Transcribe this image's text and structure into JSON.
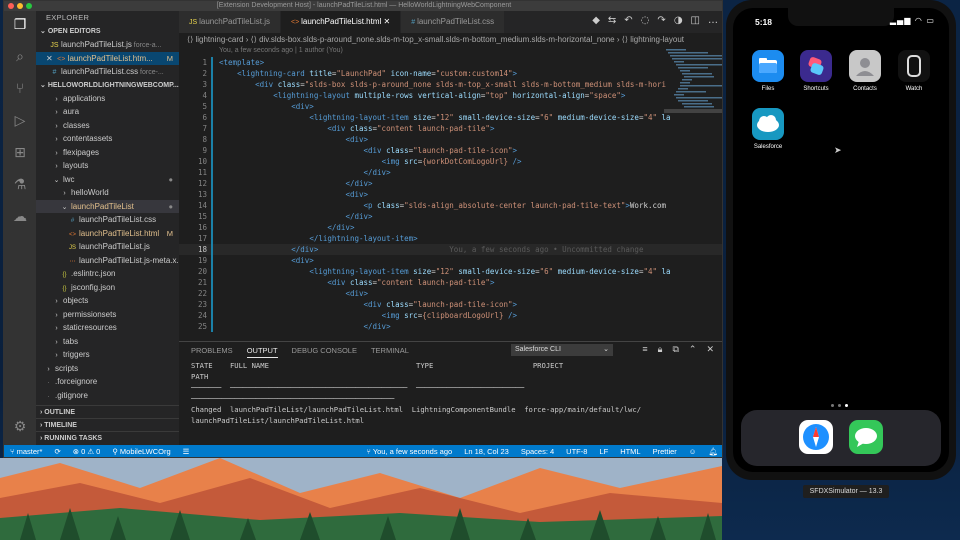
{
  "window": {
    "title": "[Extension Development Host] - launchPadTileList.html — HelloWorldLightningWebComponent"
  },
  "sidebar": {
    "explorer_title": "EXPLORER",
    "open_editors_title": "OPEN EDITORS",
    "open_editors": [
      {
        "icon": "JS",
        "name": "launchPadTileList.js",
        "extra": "force-a...",
        "mark": ""
      },
      {
        "icon": "<>",
        "name": "launchPadTileList.htm...",
        "extra": "",
        "mark": "M",
        "close": "✕"
      },
      {
        "icon": "#",
        "name": "launchPadTileList.css",
        "extra": "force-...",
        "mark": ""
      }
    ],
    "project_title": "HELLOWORLDLIGHTNINGWEBCOMP...",
    "tree": [
      {
        "name": "applications",
        "type": "folder",
        "indent": 1
      },
      {
        "name": "aura",
        "type": "folder",
        "indent": 1
      },
      {
        "name": "classes",
        "type": "folder",
        "indent": 1
      },
      {
        "name": "contentassets",
        "type": "folder",
        "indent": 1
      },
      {
        "name": "flexipages",
        "type": "folder",
        "indent": 1
      },
      {
        "name": "layouts",
        "type": "folder",
        "indent": 1
      },
      {
        "name": "lwc",
        "type": "folder-open",
        "indent": 1,
        "mark": "●"
      },
      {
        "name": "helloWorld",
        "type": "folder",
        "indent": 2
      },
      {
        "name": "launchPadTileList",
        "type": "folder-open",
        "indent": 2,
        "mark": "●"
      },
      {
        "name": "launchPadTileList.css",
        "type": "css",
        "indent": 3
      },
      {
        "name": "launchPadTileList.html",
        "type": "html",
        "indent": 3,
        "mark": "M"
      },
      {
        "name": "launchPadTileList.js",
        "type": "js",
        "indent": 3
      },
      {
        "name": "launchPadTileList.js-meta.x...",
        "type": "xml",
        "indent": 3
      },
      {
        "name": ".eslintrc.json",
        "type": "json",
        "indent": 2
      },
      {
        "name": "jsconfig.json",
        "type": "json",
        "indent": 2
      },
      {
        "name": "objects",
        "type": "folder",
        "indent": 1
      },
      {
        "name": "permissionsets",
        "type": "folder",
        "indent": 1
      },
      {
        "name": "staticresources",
        "type": "folder",
        "indent": 1
      },
      {
        "name": "tabs",
        "type": "folder",
        "indent": 1
      },
      {
        "name": "triggers",
        "type": "folder",
        "indent": 1
      },
      {
        "name": "scripts",
        "type": "folder",
        "indent": 0
      },
      {
        "name": ".forceignore",
        "type": "file",
        "indent": 0
      },
      {
        "name": ".gitignore",
        "type": "file",
        "indent": 0
      }
    ],
    "bottom_sections": [
      "OUTLINE",
      "TIMELINE",
      "RUNNING TASKS"
    ]
  },
  "tabs": [
    {
      "label": "launchPadTileList.js",
      "icon": "JS"
    },
    {
      "label": "launchPadTileList.html",
      "icon": "<>",
      "active": true,
      "close": "✕"
    },
    {
      "label": "launchPadTileList.css",
      "icon": "#"
    }
  ],
  "breadcrumb": "⟨⟩ lightning-card  ›  ⟨⟩ div.slds-box.slds-p-around_none.slds-m-top_x-small.slds-m-bottom_medium.slds-m-horizontal_none  ›  ⟨⟩ lightning-layout",
  "blame": "You, a few seconds ago | 1 author (You)",
  "code_lines": [
    {
      "n": "1",
      "html": "<span class='tag'>&lt;template&gt;</span>"
    },
    {
      "n": "2",
      "html": "    <span class='tag'>&lt;lightning-card</span> <span class='attr'>title</span><span class='txt'>=</span><span class='str'>\"LaunchPad\"</span> <span class='attr'>icon-name</span><span class='txt'>=</span><span class='str'>\"custom:custom14\"</span><span class='tag'>&gt;</span>"
    },
    {
      "n": "3",
      "html": "        <span class='tag'>&lt;div</span> <span class='attr'>class</span><span class='txt'>=</span><span class='str'>\"slds-box slds-p-around_none slds-m-top_x-small slds-m-bottom_medium slds-m-hori</span>"
    },
    {
      "n": "4",
      "html": "            <span class='tag'>&lt;lightning-layout</span> <span class='attr'>multiple-rows</span> <span class='attr'>vertical-align</span><span class='txt'>=</span><span class='str'>\"top\"</span> <span class='attr'>horizontal-align</span><span class='txt'>=</span><span class='str'>\"space\"</span><span class='tag'>&gt;</span>"
    },
    {
      "n": "5",
      "html": "                <span class='tag'>&lt;div&gt;</span>"
    },
    {
      "n": "6",
      "html": "                    <span class='tag'>&lt;lightning-layout-item</span> <span class='attr'>size</span><span class='txt'>=</span><span class='str'>\"12\"</span> <span class='attr'>small-device-size</span><span class='txt'>=</span><span class='str'>\"6\"</span> <span class='attr'>medium-device-size</span><span class='txt'>=</span><span class='str'>\"4\"</span> <span class='attr'>la</span>"
    },
    {
      "n": "7",
      "html": "                        <span class='tag'>&lt;div</span> <span class='attr'>class</span><span class='txt'>=</span><span class='str'>\"content launch-pad-tile\"</span><span class='tag'>&gt;</span>"
    },
    {
      "n": "8",
      "html": "                            <span class='tag'>&lt;div&gt;</span>"
    },
    {
      "n": "9",
      "html": "                                <span class='tag'>&lt;div</span> <span class='attr'>class</span><span class='txt'>=</span><span class='str'>\"launch-pad-tile-icon\"</span><span class='tag'>&gt;</span>"
    },
    {
      "n": "10",
      "html": "                                    <span class='tag'>&lt;img</span> <span class='attr'>src</span><span class='txt'>=</span><span class='str'>{workDotComLogoUrl}</span> <span class='tag'>/&gt;</span>"
    },
    {
      "n": "11",
      "html": "                                <span class='tag'>&lt;/div&gt;</span>"
    },
    {
      "n": "12",
      "html": "                            <span class='tag'>&lt;/div&gt;</span>"
    },
    {
      "n": "13",
      "html": "                            <span class='tag'>&lt;div&gt;</span>"
    },
    {
      "n": "14",
      "html": "                                <span class='tag'>&lt;p</span> <span class='attr'>class</span><span class='txt'>=</span><span class='str'>\"slds-align_absolute-center launch-pad-tile-text\"</span><span class='tag'>&gt;</span><span class='txt'>Work.com</span>"
    },
    {
      "n": "15",
      "html": "                            <span class='tag'>&lt;/div&gt;</span>"
    },
    {
      "n": "16",
      "html": "                        <span class='tag'>&lt;/div&gt;</span>"
    },
    {
      "n": "17",
      "html": "                    <span class='tag'>&lt;/lightning-layout-item&gt;</span>"
    },
    {
      "n": "18",
      "html": "                <span class='tag'>&lt;/div&gt;</span>                             <span class='ghost'>You, a few seconds ago • Uncommitted change</span>",
      "current": true
    },
    {
      "n": "19",
      "html": "                <span class='tag'>&lt;div&gt;</span>"
    },
    {
      "n": "20",
      "html": "                    <span class='tag'>&lt;lightning-layout-item</span> <span class='attr'>size</span><span class='txt'>=</span><span class='str'>\"12\"</span> <span class='attr'>small-device-size</span><span class='txt'>=</span><span class='str'>\"6\"</span> <span class='attr'>medium-device-size</span><span class='txt'>=</span><span class='str'>\"4\"</span> <span class='attr'>la</span>"
    },
    {
      "n": "21",
      "html": "                        <span class='tag'>&lt;div</span> <span class='attr'>class</span><span class='txt'>=</span><span class='str'>\"content launch-pad-tile\"</span><span class='tag'>&gt;</span>"
    },
    {
      "n": "22",
      "html": "                            <span class='tag'>&lt;div&gt;</span>"
    },
    {
      "n": "23",
      "html": "                                <span class='tag'>&lt;div</span> <span class='attr'>class</span><span class='txt'>=</span><span class='str'>\"launch-pad-tile-icon\"</span><span class='tag'>&gt;</span>"
    },
    {
      "n": "24",
      "html": "                                    <span class='tag'>&lt;img</span> <span class='attr'>src</span><span class='txt'>=</span><span class='str'>{clipboardLogoUrl}</span> <span class='tag'>/&gt;</span>"
    },
    {
      "n": "25",
      "html": "                                <span class='tag'>&lt;/div&gt;</span>"
    }
  ],
  "panel": {
    "tabs": [
      "PROBLEMS",
      "OUTPUT",
      "DEBUG CONSOLE",
      "TERMINAL"
    ],
    "active_tab": "OUTPUT",
    "channel": "Salesforce CLI",
    "lines": [
      "STATE    FULL NAME                                  TYPE                       PROJECT",
      "PATH",
      "───────  ─────────────────────────────────────────  ─────────────────────────",
      "───────────────────────────────────────────────",
      "Changed  launchPadTileList/launchPadTileList.html  LightningComponentBundle  force-app/main/default/lwc/",
      "launchPadTileList/launchPadTileList.html"
    ]
  },
  "status": {
    "branch": "master*",
    "sync": "⟳",
    "problems": "⊗ 0  ⚠ 0",
    "org": "MobileLWCOrg",
    "blame": "You, a few seconds ago",
    "position": "Ln 18, Col 23",
    "spaces": "Spaces: 4",
    "encoding": "UTF-8",
    "eol": "LF",
    "language": "HTML",
    "formatter": "Prettier"
  },
  "phone": {
    "time": "5:18",
    "apps": [
      {
        "label": "Files",
        "color": "#1c8cf0"
      },
      {
        "label": "Shortcuts",
        "color": "#3b2a8e"
      },
      {
        "label": "Contacts",
        "color": "#c8c8c8"
      },
      {
        "label": "Watch",
        "color": "#111111"
      },
      {
        "label": "Salesforce",
        "color": "#ffffff"
      }
    ],
    "dock": [
      {
        "name": "safari",
        "color": "#ffffff"
      },
      {
        "name": "messages",
        "color": "#34c759"
      }
    ]
  },
  "simulator_label": "SFDXSimulator — 13.3"
}
